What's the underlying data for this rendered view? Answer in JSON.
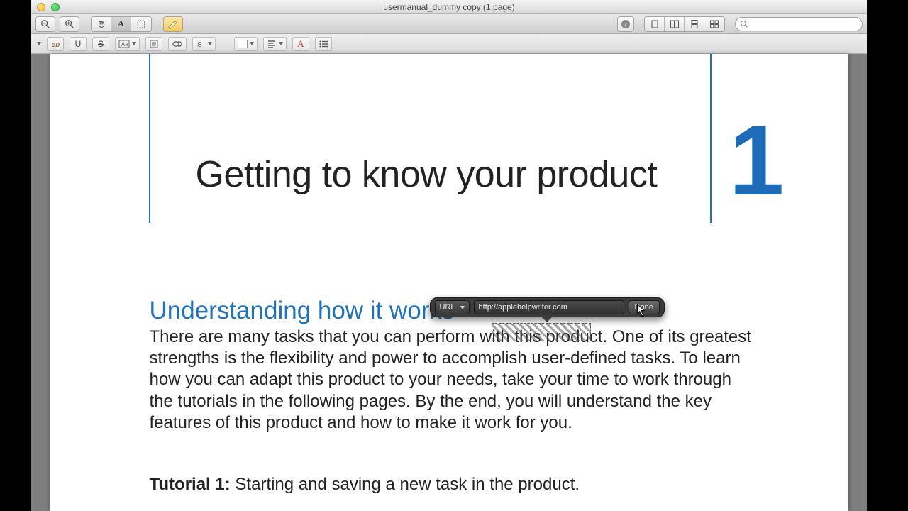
{
  "window": {
    "title": "usermanual_dummy copy (1 page)"
  },
  "toolbar": {
    "zoom_out": "−",
    "zoom_in": "+",
    "info": "i",
    "search_placeholder": ""
  },
  "link_popover": {
    "type_label": "URL",
    "url_value": "http://applehelpwriter.com",
    "done_label": "Done"
  },
  "doc": {
    "chapter_number": "1",
    "chapter_title": "Getting to know your product",
    "section_title": "Understanding how it works",
    "body_pre": "There are many tasks that you can perform with ",
    "body_link": "this product",
    "body_post": ".  One of its greatest strengths is the flexibility and power to accomplish user-defined tasks. To learn how you can adapt this product to your needs, take your time to work through the tutorials in the following pages. By the end, you will understand the key features of this product and how to make it work for you.",
    "tutorial_label": "Tutorial 1:",
    "tutorial_text": " Starting and saving a new task in the product."
  }
}
